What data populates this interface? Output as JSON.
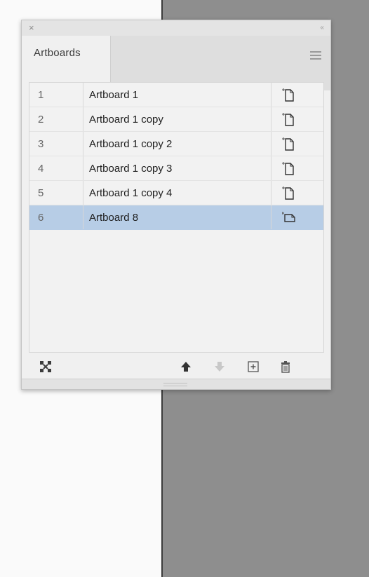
{
  "panel": {
    "close_glyph": "×",
    "collapse_glyph": "‹‹",
    "tab_label": "Artboards",
    "menu_icon": "panel-menu-icon"
  },
  "artboards": [
    {
      "number": "1",
      "name": "Artboard 1",
      "selected": false
    },
    {
      "number": "2",
      "name": "Artboard 1 copy",
      "selected": false
    },
    {
      "number": "3",
      "name": "Artboard 1 copy 2",
      "selected": false
    },
    {
      "number": "4",
      "name": "Artboard 1 copy 3",
      "selected": false
    },
    {
      "number": "5",
      "name": "Artboard 1 copy 4",
      "selected": false
    },
    {
      "number": "6",
      "name": "Artboard 8",
      "selected": true
    }
  ],
  "toolbar": {
    "rearrange": "rearrange-artboards-icon",
    "move_up": "move-up-icon",
    "move_down": "move-down-icon",
    "new_artboard": "new-artboard-icon",
    "delete": "delete-artboard-icon"
  },
  "colors": {
    "selection": "#b7cde6",
    "canvas": "#8e8e8e",
    "panel_bg": "#f0f0f0"
  }
}
